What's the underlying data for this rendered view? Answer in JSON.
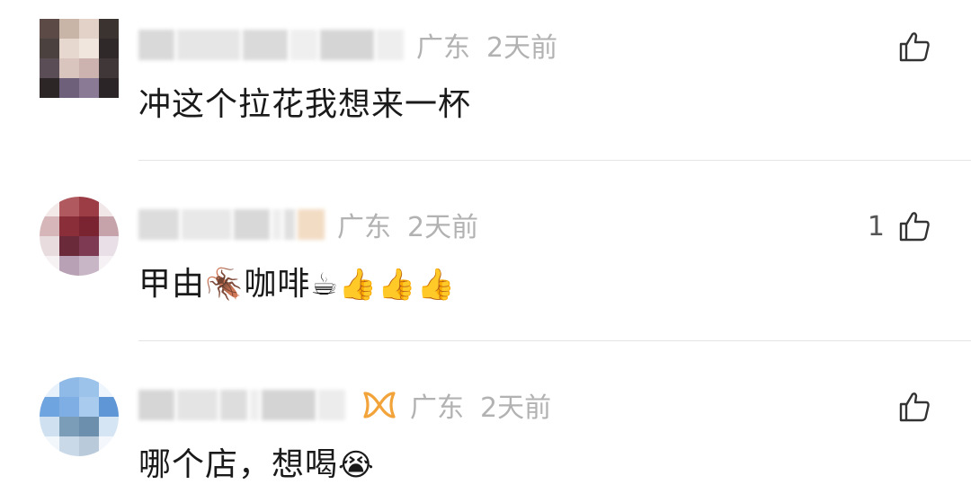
{
  "comments": [
    {
      "location": "广东",
      "time": "2天前",
      "text": "冲这个拉花我想来一杯",
      "like_count": "",
      "avatar_colors": [
        "#5b4a45",
        "#c9b4a8",
        "#e3d2c7",
        "#3a3330",
        "#4b4240",
        "#e6d8cf",
        "#f1e6de",
        "#2f2a29",
        "#5a4d55",
        "#d9c5bd",
        "#cdb3b0",
        "#403838",
        "#2c2626",
        "#6e5f7a",
        "#8a7a95",
        "#2b2527"
      ]
    },
    {
      "location": "广东",
      "time": "2天前",
      "text": "甲由",
      "text_after_emoji": "咖啡",
      "emojis": [
        "🪳",
        "☕",
        "👍",
        "👍",
        "👍"
      ],
      "like_count": "1",
      "avatar_colors": [
        "#f3e9e9",
        "#b05a5f",
        "#9c3c45",
        "#f1e6e8",
        "#d7b6ba",
        "#8a2e3a",
        "#7a2432",
        "#c6a3ab",
        "#e9dcdf",
        "#6b2a3a",
        "#7d3a52",
        "#e8e0e6",
        "#f6f1f3",
        "#b8a0b5",
        "#c8b6c6",
        "#f5f1f4"
      ]
    },
    {
      "location": "广东",
      "time": "2天前",
      "text": "哪个店，想喝",
      "emojis": [
        "😭"
      ],
      "like_count": "",
      "avatar_colors": [
        "#e7f1fb",
        "#8fb9e6",
        "#9cc3ea",
        "#eef5fc",
        "#6ea4df",
        "#7eaee3",
        "#a9cbee",
        "#5f97d6",
        "#cfe0f1",
        "#7c9db8",
        "#6d8fae",
        "#d6e5f3",
        "#f2f7fc",
        "#c9d9e8",
        "#b9cbdb",
        "#f4f8fc"
      ]
    }
  ]
}
